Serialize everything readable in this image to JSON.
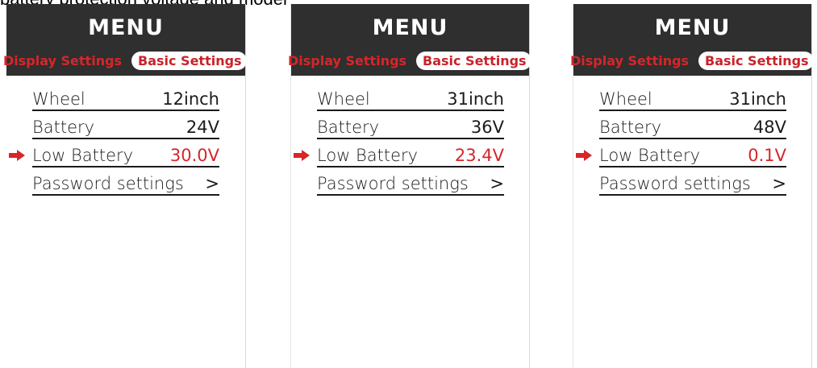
{
  "caption": "battery protection voltage and model",
  "screens": [
    {
      "title": "MENU",
      "tabs": {
        "inactive": "Display Settings",
        "active": "Basic Settings"
      },
      "rows": [
        {
          "label": "Wheel",
          "value": "12inch"
        },
        {
          "label": "Battery",
          "value": "24V"
        },
        {
          "label": "Low Battery",
          "value": "30.0V",
          "selected": true
        },
        {
          "label": "Password settings",
          "value": ">"
        }
      ]
    },
    {
      "title": "MENU",
      "tabs": {
        "inactive": "Display Settings",
        "active": "Basic Settings"
      },
      "rows": [
        {
          "label": "Wheel",
          "value": "31inch"
        },
        {
          "label": "Battery",
          "value": "36V"
        },
        {
          "label": "Low Battery",
          "value": "23.4V",
          "selected": true
        },
        {
          "label": "Password settings",
          "value": ">"
        }
      ]
    },
    {
      "title": "MENU",
      "tabs": {
        "inactive": "Display Settings",
        "active": "Basic Settings"
      },
      "rows": [
        {
          "label": "Wheel",
          "value": "31inch"
        },
        {
          "label": "Battery",
          "value": "48V"
        },
        {
          "label": "Low Battery",
          "value": "0.1V",
          "selected": true
        },
        {
          "label": "Password settings",
          "value": ">"
        }
      ]
    }
  ],
  "colors": {
    "header": "#2f2f2f",
    "accent": "#d6262a",
    "text": "#1b1b1b"
  },
  "icons": {
    "selector": "right-arrow-icon"
  }
}
